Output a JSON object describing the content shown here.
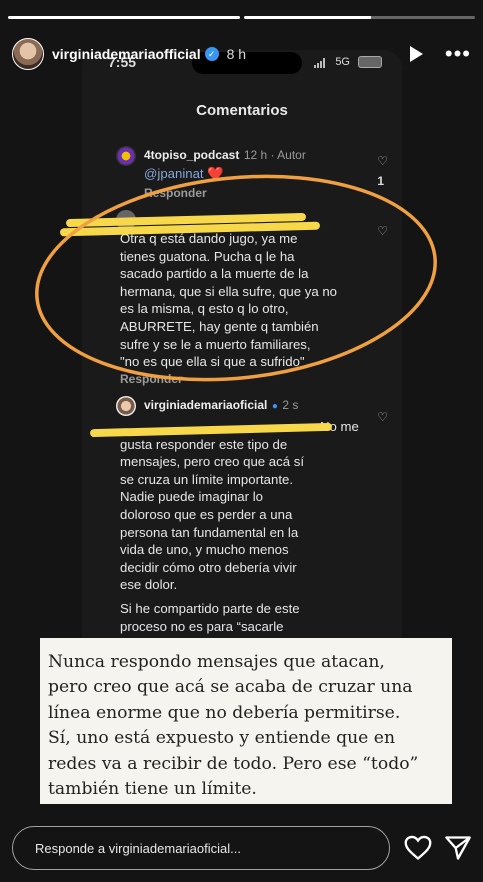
{
  "story": {
    "progress": [
      1,
      0.55
    ],
    "username": "virginiademariaofficial",
    "time": "8 h",
    "icons": {
      "verified": "verified-badge-icon",
      "play": "play-icon",
      "more": "more-options-icon"
    }
  },
  "phone": {
    "status_time": "7:55",
    "network": "5G",
    "title": "Comentarios",
    "comments": [
      {
        "user": "4topiso_podcast",
        "meta": "12 h · Autor",
        "mention": "@jpaninat",
        "emoji": "❤️",
        "reply_label": "Responder",
        "likes": "1"
      },
      {
        "text_lines": [
          "Otra q está dando jugo, ya me",
          "tienes guatona. Pucha q le ha",
          "sacado partido a la muerte de la",
          "hermana, que si ella sufre, que ya no",
          "es la misma, q esto q lo otro,",
          "ABURRETE, hay gente q también",
          "sufre y se le a muerto familiares,",
          "\"no es que ella si que a sufrido\""
        ],
        "reply_label": "Responder"
      },
      {
        "user": "virginiademariaoficial",
        "meta": "2 s",
        "text_lines": [
          "No me",
          "gusta responder este tipo de",
          "mensajes, pero creo que acá sí",
          "se cruza un límite importante.",
          "Nadie puede imaginar lo",
          "doloroso que es perder a una",
          "persona tan fundamental en la",
          "vida de uno, y mucho menos",
          "decidir cómo otro debería vivir",
          "ese dolor.",
          "Si he compartido parte de este",
          "proceso no es para “sacarle"
        ]
      }
    ]
  },
  "highlight": {
    "lines": [
      "Nunca respondo mensajes que atacan,",
      "pero creo que acá se acaba de cruzar una",
      "línea enorme que no debería permitirse.",
      "Sí, uno está expuesto y entiende que en",
      "redes va a recibir  de todo. Pero ese “todo”",
      "también tiene un límite."
    ]
  },
  "reply": {
    "placeholder": "Responde a virginiademariaoficial...",
    "icons": {
      "like": "heart-icon",
      "send": "send-icon"
    }
  },
  "colors": {
    "annotation_circle": "#f0a040",
    "scribble": "#f6d84a",
    "mention": "#85a7d8",
    "verified": "#3897f0"
  }
}
